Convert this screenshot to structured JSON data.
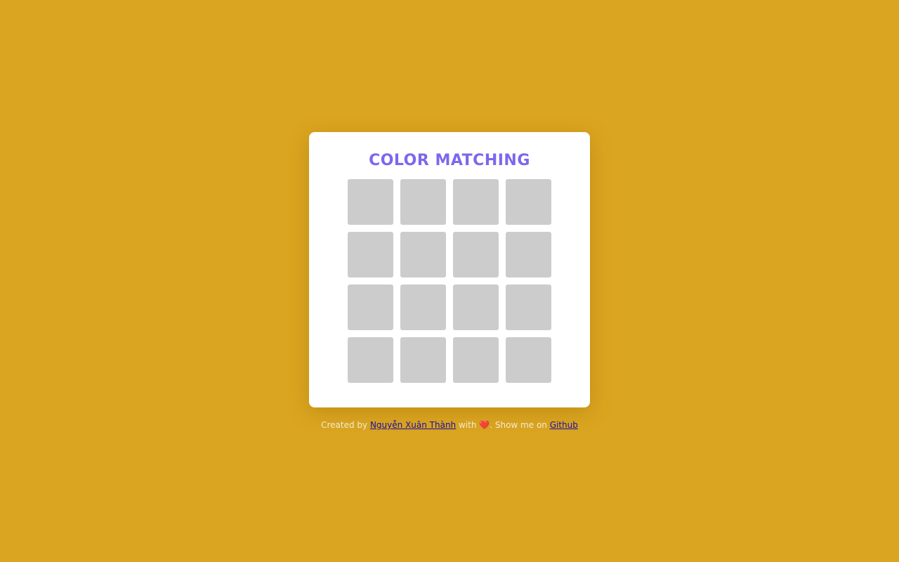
{
  "game": {
    "title": "COLOR MATCHING",
    "tiles": [
      {
        "state": "hidden"
      },
      {
        "state": "hidden"
      },
      {
        "state": "hidden"
      },
      {
        "state": "hidden"
      },
      {
        "state": "hidden"
      },
      {
        "state": "hidden"
      },
      {
        "state": "hidden"
      },
      {
        "state": "hidden"
      },
      {
        "state": "hidden"
      },
      {
        "state": "hidden"
      },
      {
        "state": "hidden"
      },
      {
        "state": "hidden"
      },
      {
        "state": "hidden"
      },
      {
        "state": "hidden"
      },
      {
        "state": "hidden"
      },
      {
        "state": "hidden"
      }
    ],
    "tile_hidden_color": "#cccccc"
  },
  "colors": {
    "background": "#daa520",
    "card": "#ffffff",
    "title": "#7b68ee",
    "footer_text": "#f2ead2",
    "link": "#1a0dab",
    "heart": "#e8472f"
  },
  "footer": {
    "created_by": "Created by",
    "author_link": "Nguyễn Xuân Thành",
    "with": "with",
    "heart_icon": "heart-icon",
    "heart_glyph": "❤️",
    "show_me_on": ". Show me on",
    "github_link": "Github"
  }
}
